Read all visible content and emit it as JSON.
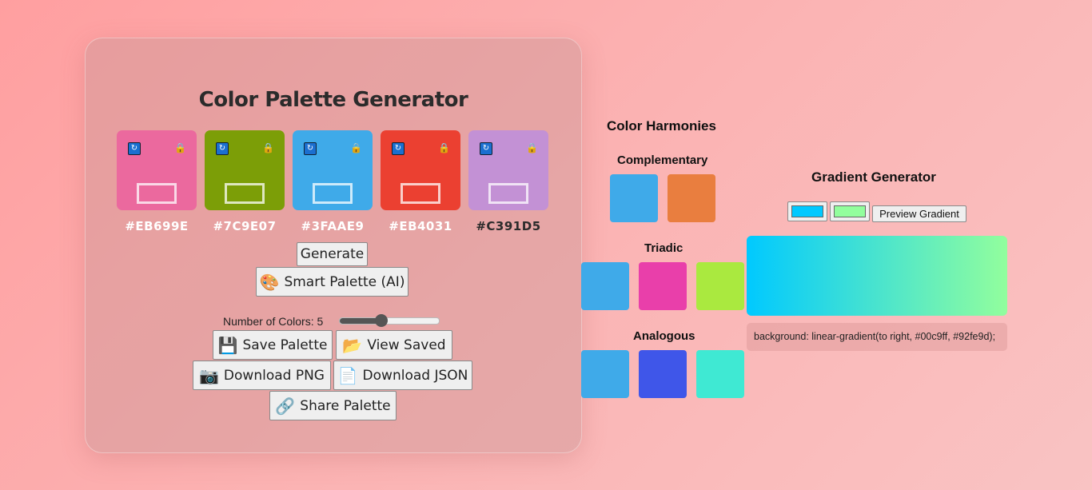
{
  "palette": {
    "title": "Color Palette Generator",
    "swatches": [
      {
        "hex": "#EB699E",
        "color": "#EB699E",
        "text_color": "#ffffff"
      },
      {
        "hex": "#7C9E07",
        "color": "#7C9E07",
        "text_color": "#ffffff"
      },
      {
        "hex": "#3FAAE9",
        "color": "#3FAAE9",
        "text_color": "#ffffff"
      },
      {
        "hex": "#EB4031",
        "color": "#EB4031",
        "text_color": "#ffffff"
      },
      {
        "hex": "#C391D5",
        "color": "#C391D5",
        "text_color": "#2b2b2b"
      }
    ],
    "generate_label": "Generate",
    "smart_label": "Smart Palette (AI)",
    "num_colors_label": "Number of Colors: 5",
    "num_colors_value": 5,
    "num_colors_fraction": 0.42,
    "save_label": "Save Palette",
    "view_saved_label": "View Saved",
    "download_png_label": "Download PNG",
    "download_json_label": "Download JSON",
    "share_label": "Share Palette"
  },
  "harmonies": {
    "title": "Color Harmonies",
    "complementary_label": "Complementary",
    "complementary": [
      "#3FAAE9",
      "#E97E3F"
    ],
    "triadic_label": "Triadic",
    "triadic": [
      "#3FAAE9",
      "#E93FAA",
      "#AAE93F"
    ],
    "analogous_label": "Analogous",
    "analogous": [
      "#3FAAE9",
      "#3F56E9",
      "#3FE9D3"
    ]
  },
  "gradient": {
    "title": "Gradient Generator",
    "color1": "#00C9FF",
    "color2": "#92FE9D",
    "preview_label": "Preview Gradient",
    "code": "background: linear-gradient(to right, #00c9ff, #92fe9d);"
  }
}
